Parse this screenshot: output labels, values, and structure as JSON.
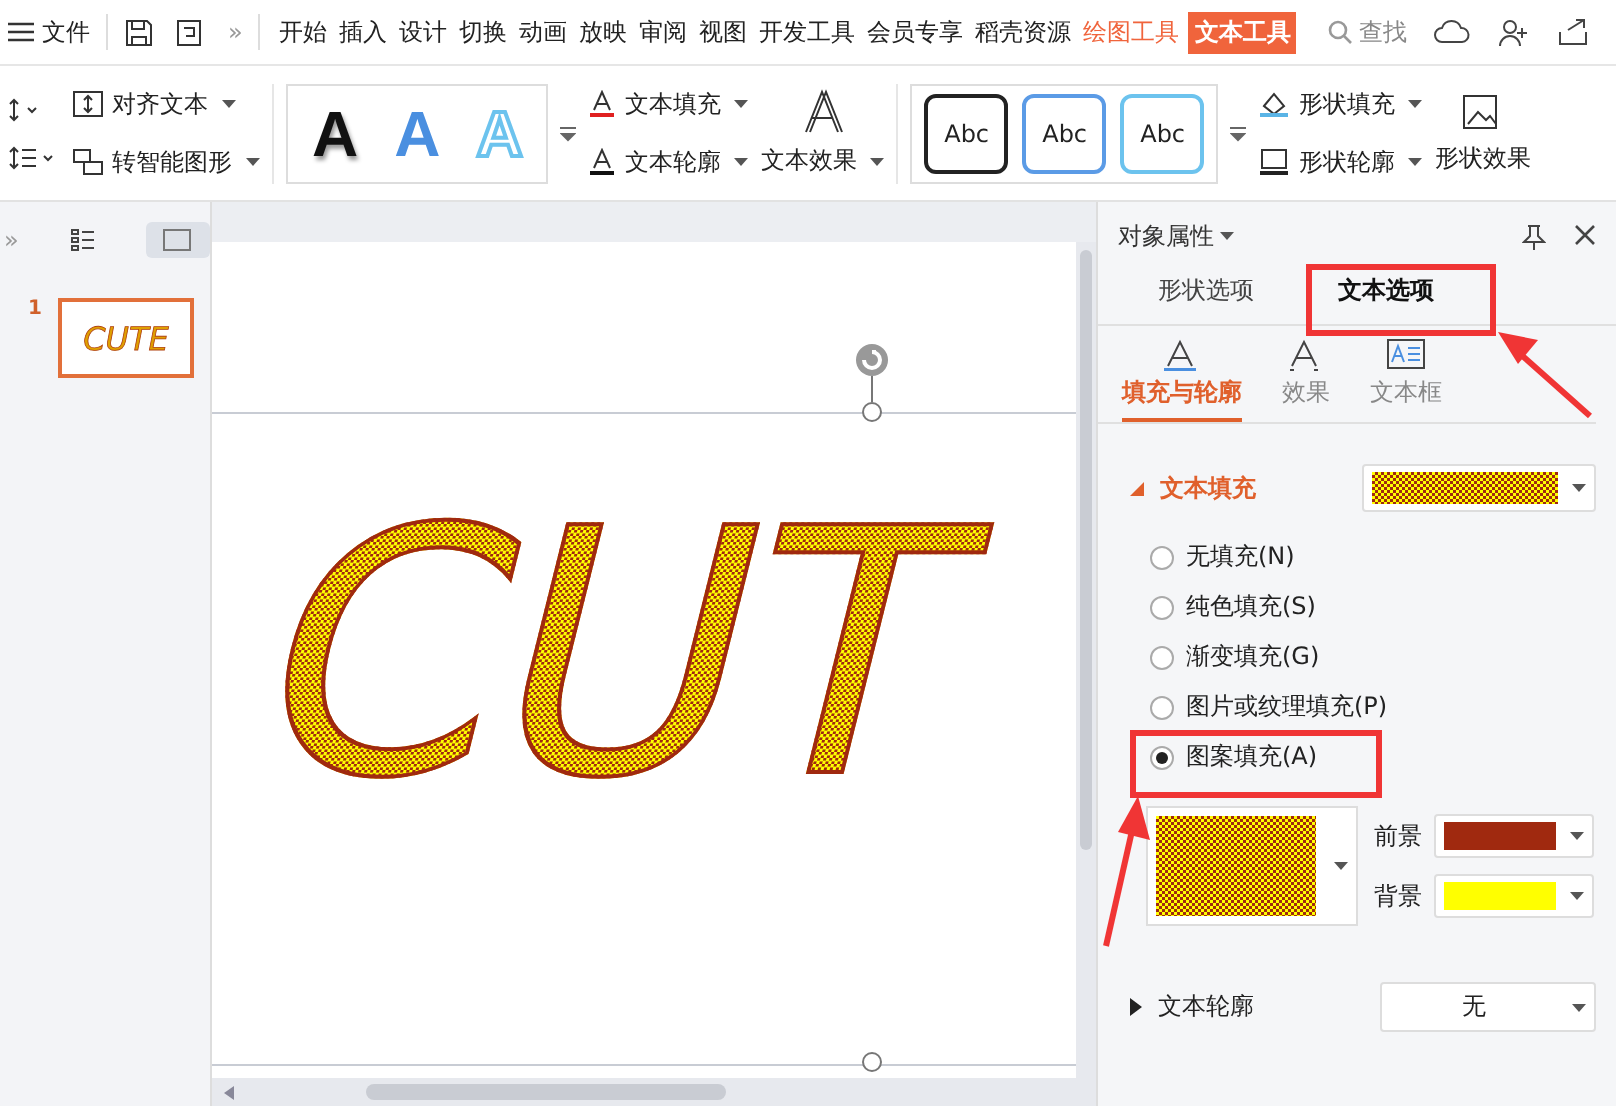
{
  "menu": {
    "file": "文件",
    "more": "»",
    "tabs": [
      {
        "label": "开始",
        "kind": "normal",
        "selected": false
      },
      {
        "label": "插入",
        "kind": "normal",
        "selected": false
      },
      {
        "label": "设计",
        "kind": "normal",
        "selected": false
      },
      {
        "label": "切换",
        "kind": "normal",
        "selected": false
      },
      {
        "label": "动画",
        "kind": "normal",
        "selected": false
      },
      {
        "label": "放映",
        "kind": "normal",
        "selected": false
      },
      {
        "label": "审阅",
        "kind": "normal",
        "selected": false
      },
      {
        "label": "视图",
        "kind": "normal",
        "selected": false
      },
      {
        "label": "开发工具",
        "kind": "normal",
        "selected": false
      },
      {
        "label": "会员专享",
        "kind": "normal",
        "selected": false
      },
      {
        "label": "稻壳资源",
        "kind": "normal",
        "selected": false
      },
      {
        "label": "绘图工具",
        "kind": "context",
        "selected": false
      },
      {
        "label": "文本工具",
        "kind": "context",
        "selected": true
      }
    ],
    "search": "查找"
  },
  "ribbon": {
    "align_text": "对齐文本",
    "smart_art": "转智能图形",
    "text_styles": [
      "A",
      "A",
      "A"
    ],
    "text_fill": "文本填充",
    "text_outline": "文本轮廓",
    "text_effect": "文本效果",
    "shape_styles": [
      "Abc",
      "Abc",
      "Abc"
    ],
    "shape_fill": "形状填充",
    "shape_outline": "形状轮廓",
    "shape_effect": "形状效果"
  },
  "slides_panel": {
    "expand": "»"
  },
  "slides": [
    {
      "number": "1",
      "thumbnail_text": "CUTE",
      "selected": true
    }
  ],
  "canvas": {
    "text": "CUT"
  },
  "panel": {
    "title": "对象属性",
    "tabs": [
      {
        "label": "形状选项",
        "selected": false
      },
      {
        "label": "文本选项",
        "selected": true
      }
    ],
    "subtabs": [
      {
        "label": "填充与轮廓",
        "selected": true
      },
      {
        "label": "效果",
        "selected": false
      },
      {
        "label": "文本框",
        "selected": false
      }
    ],
    "text_fill": {
      "label": "文本填充",
      "expanded": true,
      "options": [
        {
          "label": "无填充(N)",
          "selected": false
        },
        {
          "label": "纯色填充(S)",
          "selected": false
        },
        {
          "label": "渐变填充(G)",
          "selected": false
        },
        {
          "label": "图片或纹理填充(P)",
          "selected": false
        },
        {
          "label": "图案填充(A)",
          "selected": true
        }
      ],
      "foreground": {
        "label": "前景",
        "color": "#a0290f"
      },
      "background": {
        "label": "背景",
        "color": "#ffff00"
      }
    },
    "text_outline": {
      "label": "文本轮廓",
      "expanded": false,
      "value": "无"
    }
  }
}
